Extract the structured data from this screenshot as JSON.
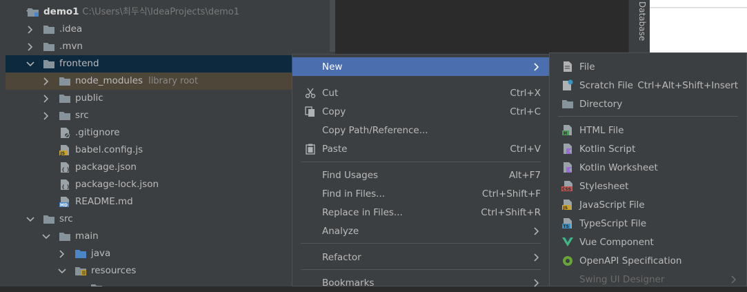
{
  "tree": {
    "root": {
      "name": "demo1",
      "path": "C:\\Users\\최두식\\IdeaProjects\\demo1"
    },
    "items": [
      {
        "label": ".idea"
      },
      {
        "label": ".mvn"
      },
      {
        "label": "frontend"
      },
      {
        "label": "node_modules",
        "hint": "library root"
      },
      {
        "label": "public"
      },
      {
        "label": "src"
      },
      {
        "label": ".gitignore"
      },
      {
        "label": "babel.config.js"
      },
      {
        "label": "package.json"
      },
      {
        "label": "package-lock.json"
      },
      {
        "label": "README.md"
      },
      {
        "label": "src"
      },
      {
        "label": "main"
      },
      {
        "label": "java"
      },
      {
        "label": "resources"
      }
    ]
  },
  "side_panel": {
    "database_label": "Database"
  },
  "context_menu": {
    "new": "New",
    "cut": "Cut",
    "cut_key": "Ctrl+X",
    "copy": "Copy",
    "copy_key": "Ctrl+C",
    "copy_path": "Copy Path/Reference...",
    "paste": "Paste",
    "paste_key": "Ctrl+V",
    "find_usages": "Find Usages",
    "find_usages_key": "Alt+F7",
    "find_in_files": "Find in Files...",
    "find_in_files_key": "Ctrl+Shift+F",
    "replace_in_files": "Replace in Files...",
    "replace_in_files_key": "Ctrl+Shift+R",
    "analyze": "Analyze",
    "refactor": "Refactor",
    "bookmarks": "Bookmarks"
  },
  "new_submenu": {
    "file": "File",
    "scratch_file": "Scratch File",
    "scratch_file_key": "Ctrl+Alt+Shift+Insert",
    "directory": "Directory",
    "html_file": "HTML File",
    "kotlin_script": "Kotlin Script",
    "kotlin_worksheet": "Kotlin Worksheet",
    "stylesheet": "Stylesheet",
    "javascript_file": "JavaScript File",
    "typescript_file": "TypeScript File",
    "vue_component": "Vue Component",
    "openapi_spec": "OpenAPI Specification",
    "swing_ui_designer": "Swing UI Designer"
  },
  "colors": {
    "selection": "#4b6eaf",
    "tree_selected": "#0d293e",
    "library_row": "#4e4638",
    "folder": "#87939a",
    "java_folder": "#4a86c8"
  }
}
